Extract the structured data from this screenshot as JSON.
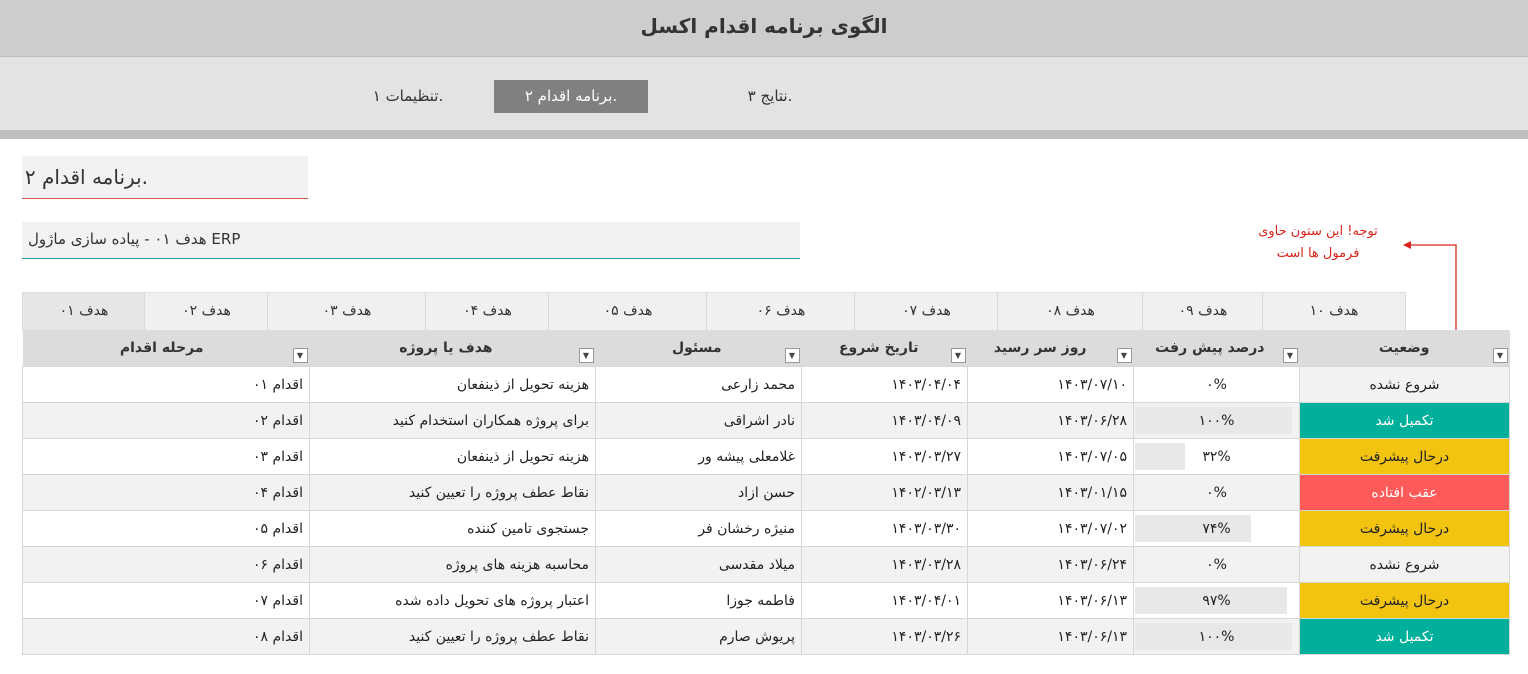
{
  "app": {
    "title": "الگوی برنامه اقدام اکسل"
  },
  "nav": {
    "settings": "تنظیمات ۱.",
    "plan": "برنامه اقدام ۲.",
    "results": "نتایج ۳."
  },
  "section_title": "برنامه اقدام ۲.",
  "goal_label": "هدف ۰۱ - پیاده سازی ماژول ERP",
  "note": {
    "line1": "توجه! این ستون حاوی",
    "line2": "فرمول ها است"
  },
  "tabs": [
    "هدف ۰۱",
    "هدف ۰۲",
    "هدف ۰۳",
    "هدف ۰۴",
    "هدف ۰۵",
    "هدف ۰۶",
    "هدف ۰۷",
    "هدف ۰۸",
    "هدف ۰۹",
    "هدف ۱۰"
  ],
  "columns": {
    "step": "مرحله اقدام",
    "goal": "هدف یا پروژه",
    "owner": "مسئول",
    "start": "تاریخ شروع",
    "due": "روز سر رسید",
    "progress": "درصد پیش رفت",
    "status": "وضعیت"
  },
  "colors": {
    "done": "#00b09b",
    "in_progress": "#f2c40f",
    "late": "#ff5a5a",
    "not_started": "#f2f2f2"
  },
  "rows": [
    {
      "step": "اقدام ۰۱",
      "goal": "هزینه تحویل از ذینفعان",
      "owner": "محمد زارعی",
      "start": "۱۴۰۳/۰۴/۰۴",
      "due": "۱۴۰۳/۰۷/۱۰",
      "progress_label": "۰%",
      "progress": 0,
      "status": "شروع نشده",
      "status_key": "not_started"
    },
    {
      "step": "اقدام ۰۲",
      "goal": "برای پروژه همکاران استخدام کنید",
      "owner": "نادر اشراقی",
      "start": "۱۴۰۳/۰۴/۰۹",
      "due": "۱۴۰۳/۰۶/۲۸",
      "progress_label": "۱۰۰%",
      "progress": 1.0,
      "status": "تکمیل شد",
      "status_key": "done"
    },
    {
      "step": "اقدام ۰۳",
      "goal": "هزینه تحویل از ذینفعان",
      "owner": "غلامعلی  پیشه ور",
      "start": "۱۴۰۳/۰۳/۲۷",
      "due": "۱۴۰۳/۰۷/۰۵",
      "progress_label": "۳۲%",
      "progress": 0.32,
      "status": "درحال پیشرفت",
      "status_key": "in_progress"
    },
    {
      "step": "اقدام ۰۴",
      "goal": "نقاط عطف پروژه را تعیین کنید",
      "owner": "حسن ازاد",
      "start": "۱۴۰۲/۰۳/۱۳",
      "due": "۱۴۰۳/۰۱/۱۵",
      "progress_label": "۰%",
      "progress": 0,
      "status": "عقب افتاده",
      "status_key": "late"
    },
    {
      "step": "اقدام ۰۵",
      "goal": "جستجوی تامین کننده",
      "owner": "منیژه رخشان فر",
      "start": "۱۴۰۳/۰۳/۳۰",
      "due": "۱۴۰۳/۰۷/۰۲",
      "progress_label": "۷۴%",
      "progress": 0.74,
      "status": "درحال پیشرفت",
      "status_key": "in_progress"
    },
    {
      "step": "اقدام ۰۶",
      "goal": "محاسبه هزینه های پروژه",
      "owner": "میلاد مقدسی",
      "start": "۱۴۰۳/۰۳/۲۸",
      "due": "۱۴۰۳/۰۶/۲۴",
      "progress_label": "۰%",
      "progress": 0,
      "status": "شروع نشده",
      "status_key": "not_started"
    },
    {
      "step": "اقدام ۰۷",
      "goal": "اعتبار پروژه های تحویل داده شده",
      "owner": "فاطمه  جوزا",
      "start": "۱۴۰۳/۰۴/۰۱",
      "due": "۱۴۰۳/۰۶/۱۳",
      "progress_label": "۹۷%",
      "progress": 0.97,
      "status": "درحال پیشرفت",
      "status_key": "in_progress"
    },
    {
      "step": "اقدام ۰۸",
      "goal": "نقاط عطف پروژه را تعیین کنید",
      "owner": "پریوش صارم",
      "start": "۱۴۰۳/۰۳/۲۶",
      "due": "۱۴۰۳/۰۶/۱۳",
      "progress_label": "۱۰۰%",
      "progress": 1.0,
      "status": "تکمیل شد",
      "status_key": "done"
    }
  ]
}
